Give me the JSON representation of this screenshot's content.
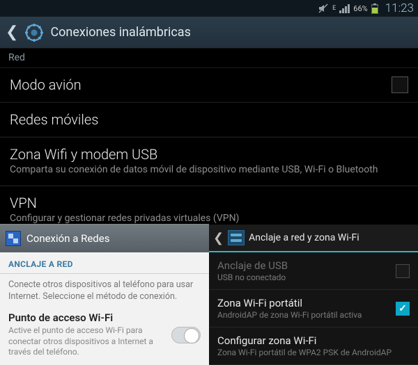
{
  "status": {
    "network_type": "E",
    "battery": "66%",
    "time": "11:23"
  },
  "header": {
    "title": "Conexiones inalámbricas"
  },
  "section_label": "Red",
  "rows": {
    "airplane": {
      "title": "Modo avión"
    },
    "mobile": {
      "title": "Redes móviles"
    },
    "hotspot": {
      "title": "Zona Wifi y modem USB",
      "subtitle": "Comparta su conexión de datos móvil de dispositivo mediante USB, Wi-Fi o Bluetooth"
    },
    "vpn": {
      "title": "VPN",
      "subtitle": "Configurar y gestionar redes privadas virtuales (VPN)"
    }
  },
  "overlay_left": {
    "title": "Conexión a Redes",
    "section": "ANCLAJE A RED",
    "intro": "Conecte otros dispositivos al teléfono para usar Internet. Seleccione el método de conexión.",
    "item1": {
      "title": "Punto de acceso Wi-Fi",
      "subtitle": "Active el punto de acceso Wi-Fi para conectar otros dispositivos a Internet a través del teléfono."
    }
  },
  "overlay_right": {
    "title": "Anclaje a red y zona Wi-Fi",
    "usb": {
      "title": "Anclaje de USB",
      "subtitle": "USB no conectado"
    },
    "wifi": {
      "title": "Zona Wi-Fi portátil",
      "subtitle": "AndroidAP de zona Wi-Fi portátil activa"
    },
    "config": {
      "title": "Configurar zona Wi-Fi",
      "subtitle": "Zona Wi-Fi portátil de WPA2 PSK de AndroidAP"
    }
  }
}
